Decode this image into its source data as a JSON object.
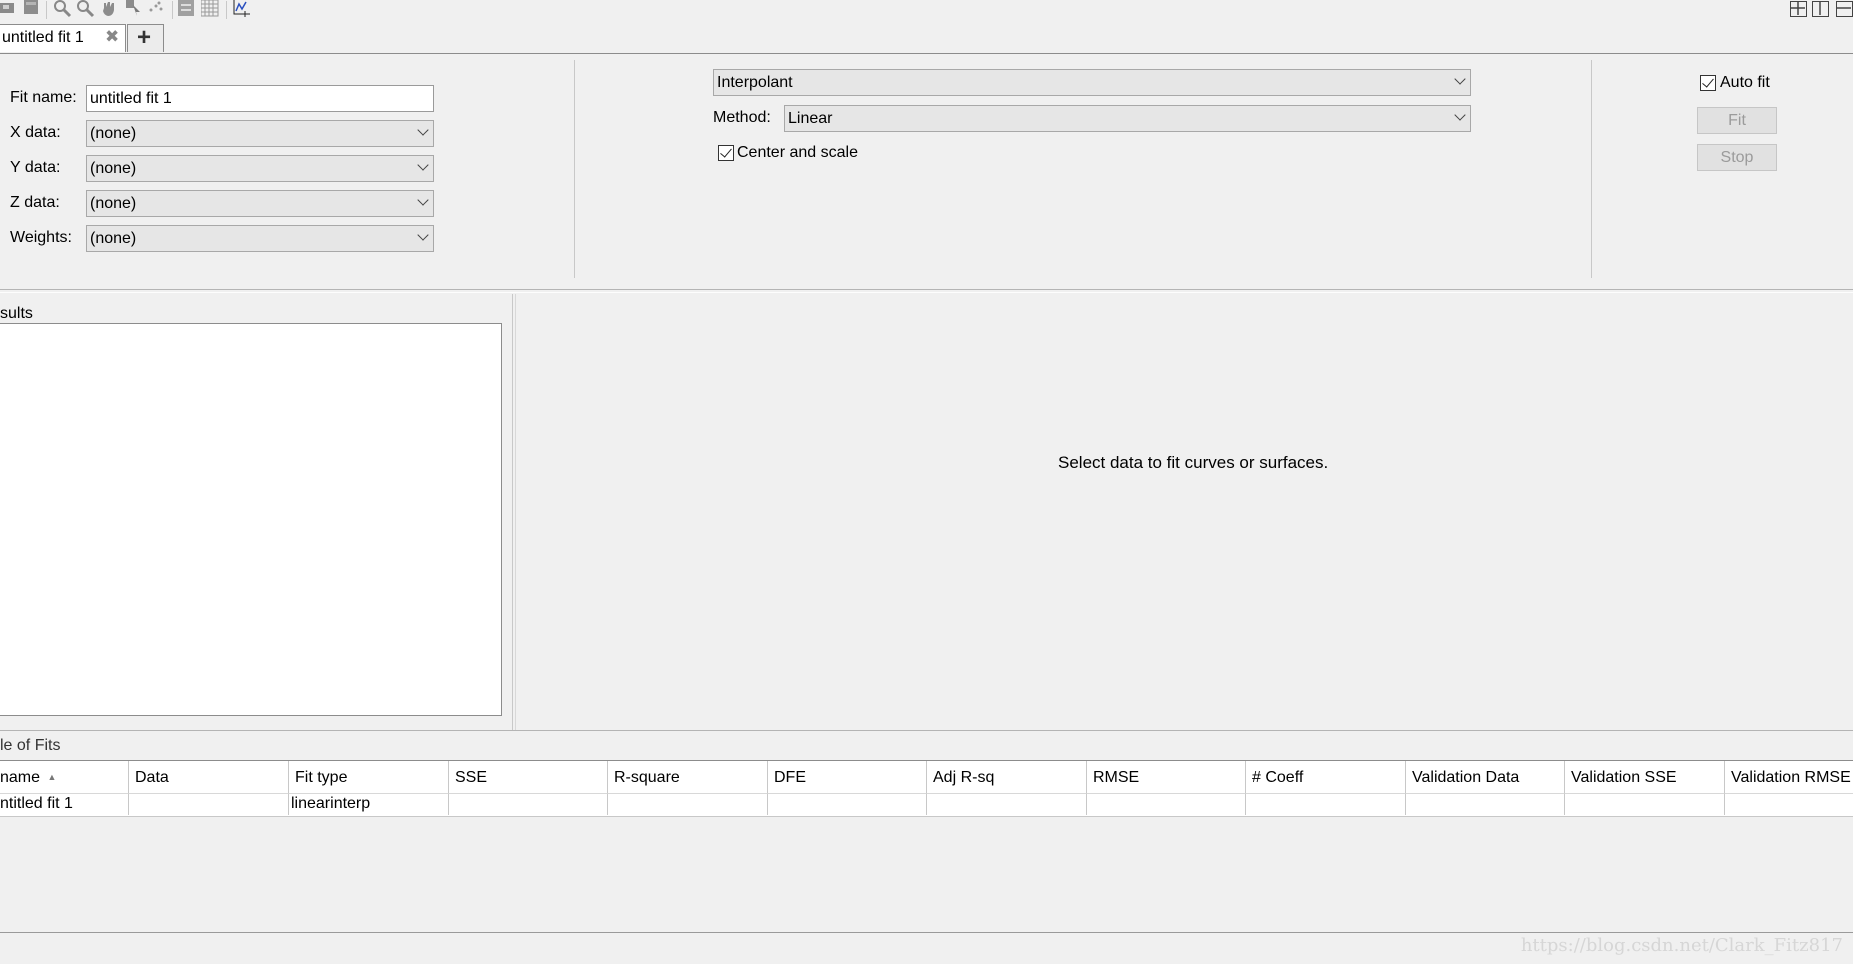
{
  "toolbar": {
    "icons": [
      "save-icon",
      "open-icon",
      "zoom-in-icon",
      "zoom-out-icon",
      "pan-icon",
      "data-cursor-icon",
      "exclude-outliers-icon",
      "legend-icon",
      "grid-icon",
      "axes-limits-icon"
    ],
    "layout_icons": [
      "tile-layout-icon",
      "side-by-side-layout-icon",
      "stacked-layout-icon"
    ]
  },
  "tabs": {
    "active_label": "untitled fit 1",
    "close_glyph": "✖",
    "add_glyph": "+"
  },
  "data_panel": {
    "fit_name_label": "Fit name:",
    "fit_name_value": "untitled fit 1",
    "x_label": "X data:",
    "x_value": "(none)",
    "y_label": "Y data:",
    "y_value": "(none)",
    "z_label": "Z data:",
    "z_value": "(none)",
    "weights_label": "Weights:",
    "weights_value": "(none)"
  },
  "fit_panel": {
    "fit_type": "Interpolant",
    "method_label": "Method:",
    "method_value": "Linear",
    "center_scale_label": "Center and scale",
    "center_scale_checked": true
  },
  "actions": {
    "auto_fit_label": "Auto fit",
    "auto_fit_checked": true,
    "fit_button": "Fit",
    "stop_button": "Stop"
  },
  "results": {
    "title": "sults"
  },
  "plot": {
    "message": "Select data to fit curves or surfaces."
  },
  "table_of_fits": {
    "title": "le of Fits",
    "columns": [
      "name",
      "Data",
      "Fit type",
      "SSE",
      "R-square",
      "DFE",
      "Adj R-sq",
      "RMSE",
      "# Coeff",
      "Validation Data",
      "Validation SSE",
      "Validation RMSE"
    ],
    "sort_glyph": "▲",
    "rows": [
      [
        "ntitled fit 1",
        "",
        "linearinterp",
        "",
        "",
        "",
        "",
        "",
        "",
        "",
        "",
        ""
      ]
    ]
  },
  "watermark": "https://blog.csdn.net/Clark_Fitz817",
  "colors": {
    "background": "#f0f0f0",
    "disabled_text": "#9b9b9b",
    "border": "#8c8c8c"
  }
}
